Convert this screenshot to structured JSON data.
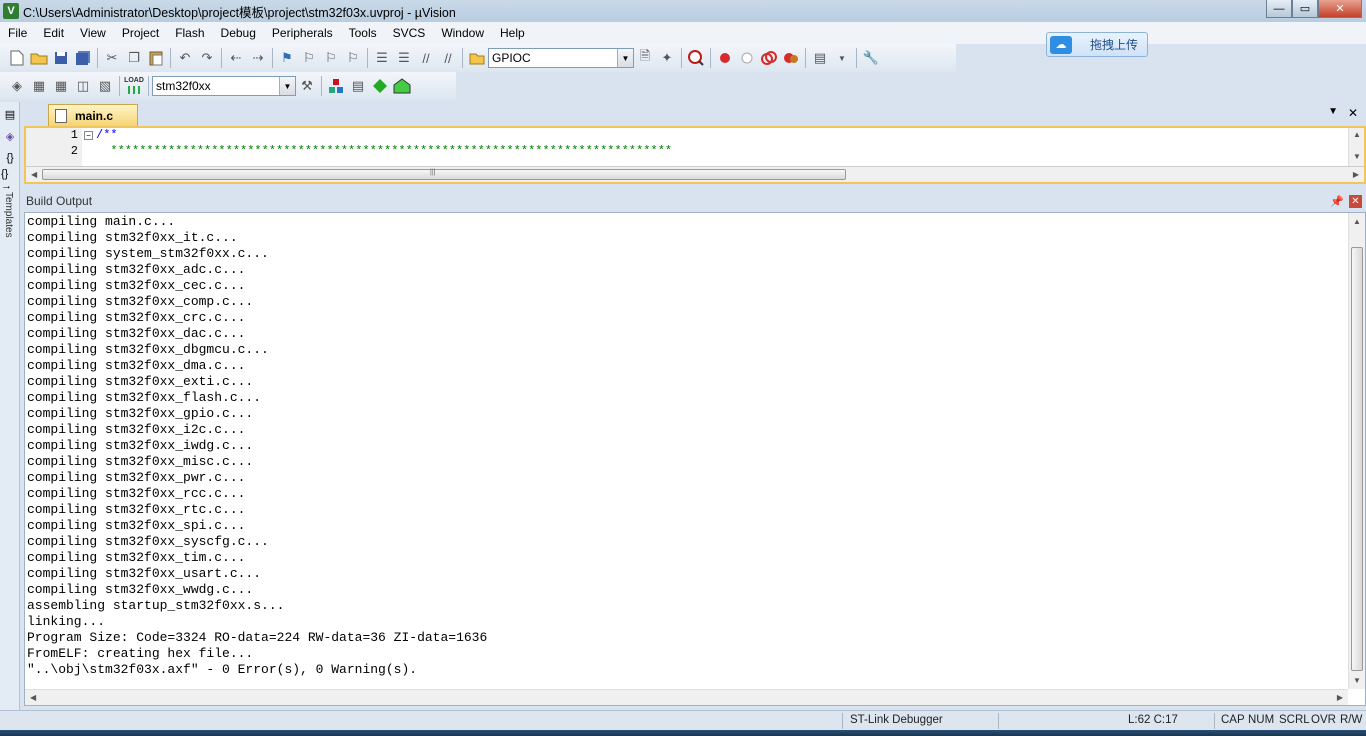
{
  "window": {
    "title": "C:\\Users\\Administrator\\Desktop\\project模板\\project\\stm32f03x.uvproj - µVision",
    "app_icon": "V",
    "controls": {
      "minimize": "—",
      "maximize": "▭",
      "close": "✕"
    }
  },
  "menu": [
    "File",
    "Edit",
    "View",
    "Project",
    "Flash",
    "Debug",
    "Peripherals",
    "Tools",
    "SVCS",
    "Window",
    "Help"
  ],
  "upload_button": {
    "label": "拖拽上传"
  },
  "toolbar": {
    "find_combo_value": "GPIOC",
    "target_combo_value": "stm32f0xx",
    "load_label": "LOAD"
  },
  "left_panel": {
    "templates_label": "Templates",
    "braces": "{}",
    "brace_arrow": "{}→"
  },
  "editor": {
    "tab_label": "main.c",
    "line_numbers": [
      "1",
      "2"
    ],
    "lines": [
      "/**",
      "  ******************************************************************************"
    ]
  },
  "build_output": {
    "title": "Build Output",
    "lines": [
      "compiling main.c...",
      "compiling stm32f0xx_it.c...",
      "compiling system_stm32f0xx.c...",
      "compiling stm32f0xx_adc.c...",
      "compiling stm32f0xx_cec.c...",
      "compiling stm32f0xx_comp.c...",
      "compiling stm32f0xx_crc.c...",
      "compiling stm32f0xx_dac.c...",
      "compiling stm32f0xx_dbgmcu.c...",
      "compiling stm32f0xx_dma.c...",
      "compiling stm32f0xx_exti.c...",
      "compiling stm32f0xx_flash.c...",
      "compiling stm32f0xx_gpio.c...",
      "compiling stm32f0xx_i2c.c...",
      "compiling stm32f0xx_iwdg.c...",
      "compiling stm32f0xx_misc.c...",
      "compiling stm32f0xx_pwr.c...",
      "compiling stm32f0xx_rcc.c...",
      "compiling stm32f0xx_rtc.c...",
      "compiling stm32f0xx_spi.c...",
      "compiling stm32f0xx_syscfg.c...",
      "compiling stm32f0xx_tim.c...",
      "compiling stm32f0xx_usart.c...",
      "compiling stm32f0xx_wwdg.c...",
      "assembling startup_stm32f0xx.s...",
      "linking...",
      "Program Size: Code=3324 RO-data=224 RW-data=36 ZI-data=1636",
      "FromELF: creating hex file...",
      "\"..\\obj\\stm32f03x.axf\" - 0 Error(s), 0 Warning(s)."
    ]
  },
  "status": {
    "debugger": "ST-Link Debugger",
    "position": "L:62 C:17",
    "cap": "CAP",
    "num": "NUM",
    "scrl": "SCRL",
    "ovr": "OVR",
    "rw": "R/W"
  }
}
